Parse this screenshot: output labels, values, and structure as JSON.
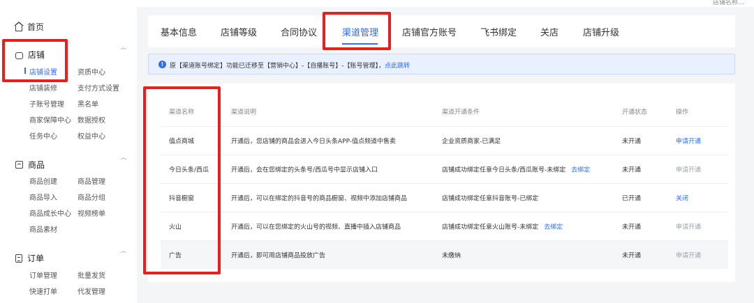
{
  "topbar": {
    "user_text": "店铺名称…"
  },
  "sidebar": {
    "home": "首页",
    "groups": [
      {
        "title": "店铺",
        "items": [
          "店铺设置",
          "资质中心",
          "店铺装修",
          "支付方式设置",
          "子账号管理",
          "黑名单",
          "商家保障中心",
          "数据授权",
          "任务中心",
          "权益中心"
        ]
      },
      {
        "title": "商品",
        "items": [
          "商品创建",
          "商品管理",
          "商品导入",
          "商品分组",
          "商品成长中心",
          "视频榜单",
          "商品素材"
        ]
      },
      {
        "title": "订单",
        "items": [
          "订单管理",
          "批量发货",
          "快速打单",
          "代发管理"
        ]
      }
    ],
    "active_item": "店铺设置"
  },
  "tabs": [
    "基本信息",
    "店铺等级",
    "合同协议",
    "渠道管理",
    "店铺官方账号",
    "飞书绑定",
    "关店",
    "店铺升级"
  ],
  "active_tab": "渠道管理",
  "notice": {
    "text": "原【渠道账号绑定】功能已迁移至【营销中心】-【自播账号】-【账号管理】，",
    "link": "点此跳转"
  },
  "table": {
    "headers": [
      "渠道名称",
      "渠道说明",
      "渠道开通条件",
      "开通状态",
      "操作"
    ],
    "rows": [
      {
        "name": "值点商城",
        "desc": "开通后，您店铺的商品会进入今日头条APP-值点频道中售卖",
        "cond": "企业资质商家-已满足",
        "cond_link": "",
        "status": "未开通",
        "action": "申请开通",
        "action_style": "link"
      },
      {
        "name": "今日头条/西瓜",
        "desc": "开通后，会在您绑定的头条号/西瓜号中显示店铺入口",
        "cond": "店铺成功绑定任意今日头条/西瓜账号-未绑定",
        "cond_link": "去绑定",
        "status": "未开通",
        "action": "申请开通",
        "action_style": "muted"
      },
      {
        "name": "抖音橱窗",
        "desc": "开通后，可以在绑定的抖音号的商品橱窗、视频中添加店铺商品",
        "cond": "店铺成功绑定任意抖音账号-已绑定",
        "cond_link": "",
        "status": "已开通",
        "action": "关闭",
        "action_style": "link"
      },
      {
        "name": "火山",
        "desc": "开通后，可以在您绑定的火山号的视频、直播中插入店铺商品",
        "cond": "店铺成功绑定任意火山账号-未绑定",
        "cond_link": "去绑定",
        "status": "未开通",
        "action": "申请开通",
        "action_style": "muted"
      },
      {
        "name": "广告",
        "desc": "开通后，即可用店铺商品投放广告",
        "cond": "未缴纳",
        "cond_link": "",
        "status": "未开通",
        "action": "申请开通",
        "action_style": "muted"
      }
    ]
  },
  "colors": {
    "accent": "#2f6bff",
    "highlight": "#e8201c"
  }
}
